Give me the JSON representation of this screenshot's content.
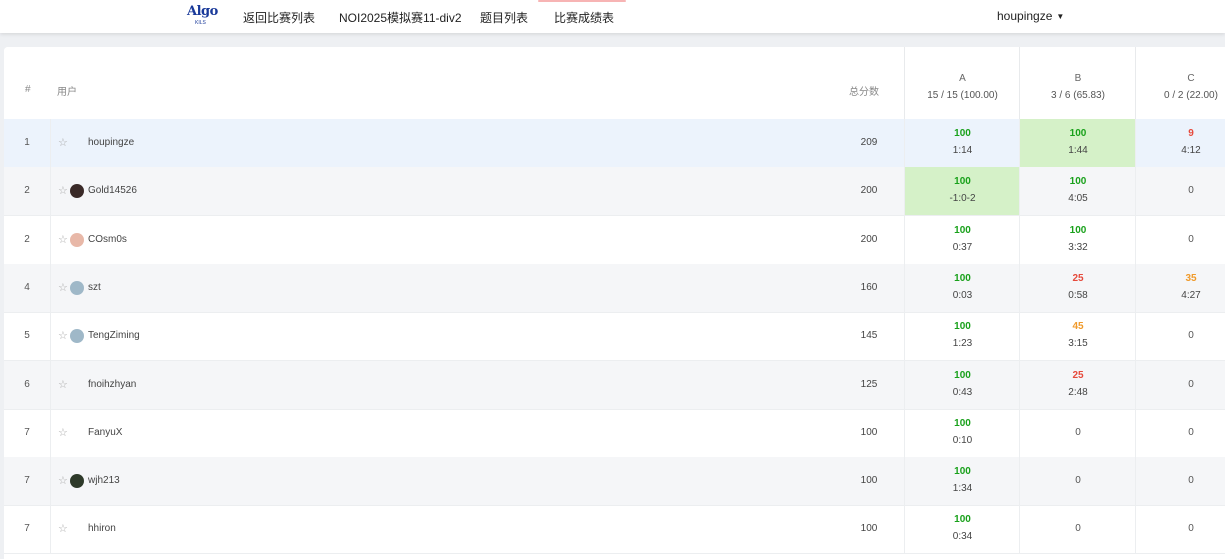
{
  "nav": {
    "logo_text": "Algo",
    "logo_sub": "KILS",
    "items": [
      "返回比赛列表",
      "NOI2025模拟赛11-div2",
      "题目列表",
      "比赛成绩表"
    ],
    "user": "houpingze"
  },
  "table": {
    "header": {
      "rank": "#",
      "user": "用户",
      "total": "总分数"
    },
    "problems": [
      {
        "letter": "A",
        "stat": "15 / 15 (100.00)"
      },
      {
        "letter": "B",
        "stat": "3 / 6 (65.83)"
      },
      {
        "letter": "C",
        "stat": "0 / 2 (22.00)"
      }
    ],
    "rows": [
      {
        "rank": "1",
        "user": "houpingze",
        "avatar": "none",
        "total": "209",
        "cells": [
          {
            "score": "100",
            "time": "1:14",
            "color": "green",
            "first": false
          },
          {
            "score": "100",
            "time": "1:44",
            "color": "green",
            "first": true
          },
          {
            "score": "9",
            "time": "4:12",
            "color": "red",
            "first": false
          }
        ]
      },
      {
        "rank": "2",
        "user": "Gold14526",
        "avatar": "#3a2a28",
        "total": "200",
        "cells": [
          {
            "score": "100",
            "time": "-1:0-2",
            "color": "green",
            "first": true
          },
          {
            "score": "100",
            "time": "4:05",
            "color": "green",
            "first": false
          },
          {
            "score": "0",
            "time": "",
            "color": "plain",
            "first": false
          }
        ]
      },
      {
        "rank": "2",
        "user": "COsm0s",
        "avatar": "#e8b8a8",
        "total": "200",
        "cells": [
          {
            "score": "100",
            "time": "0:37",
            "color": "green",
            "first": false
          },
          {
            "score": "100",
            "time": "3:32",
            "color": "green",
            "first": false
          },
          {
            "score": "0",
            "time": "",
            "color": "plain",
            "first": false
          }
        ]
      },
      {
        "rank": "4",
        "user": "szt",
        "avatar": "#9fb8c8",
        "total": "160",
        "cells": [
          {
            "score": "100",
            "time": "0:03",
            "color": "green",
            "first": false
          },
          {
            "score": "25",
            "time": "0:58",
            "color": "red",
            "first": false
          },
          {
            "score": "35",
            "time": "4:27",
            "color": "orange",
            "first": false
          }
        ]
      },
      {
        "rank": "5",
        "user": "TengZiming",
        "avatar": "#9fb8c8",
        "total": "145",
        "cells": [
          {
            "score": "100",
            "time": "1:23",
            "color": "green",
            "first": false
          },
          {
            "score": "45",
            "time": "3:15",
            "color": "orange",
            "first": false
          },
          {
            "score": "0",
            "time": "",
            "color": "plain",
            "first": false
          }
        ]
      },
      {
        "rank": "6",
        "user": "fnoihzhyan",
        "avatar": "none",
        "total": "125",
        "cells": [
          {
            "score": "100",
            "time": "0:43",
            "color": "green",
            "first": false
          },
          {
            "score": "25",
            "time": "2:48",
            "color": "red",
            "first": false
          },
          {
            "score": "0",
            "time": "",
            "color": "plain",
            "first": false
          }
        ]
      },
      {
        "rank": "7",
        "user": "FanyuX",
        "avatar": "none",
        "total": "100",
        "cells": [
          {
            "score": "100",
            "time": "0:10",
            "color": "green",
            "first": false
          },
          {
            "score": "0",
            "time": "",
            "color": "plain",
            "first": false
          },
          {
            "score": "0",
            "time": "",
            "color": "plain",
            "first": false
          }
        ]
      },
      {
        "rank": "7",
        "user": "wjh213",
        "avatar": "#2e3a2a",
        "total": "100",
        "cells": [
          {
            "score": "100",
            "time": "1:34",
            "color": "green",
            "first": false
          },
          {
            "score": "0",
            "time": "",
            "color": "plain",
            "first": false
          },
          {
            "score": "0",
            "time": "",
            "color": "plain",
            "first": false
          }
        ]
      },
      {
        "rank": "7",
        "user": "hhiron",
        "avatar": "none",
        "total": "100",
        "cells": [
          {
            "score": "100",
            "time": "0:34",
            "color": "green",
            "first": false
          },
          {
            "score": "0",
            "time": "",
            "color": "plain",
            "first": false
          },
          {
            "score": "0",
            "time": "",
            "color": "plain",
            "first": false
          }
        ]
      }
    ]
  },
  "colors": {
    "accepted": "#19a11b",
    "partial_low": "#e64a3c",
    "partial_mid": "#f09a2a",
    "first_blood_bg": "#d5f1c8"
  },
  "icons": {
    "star": "star-outline-icon",
    "caret": "chevron-down-icon"
  }
}
